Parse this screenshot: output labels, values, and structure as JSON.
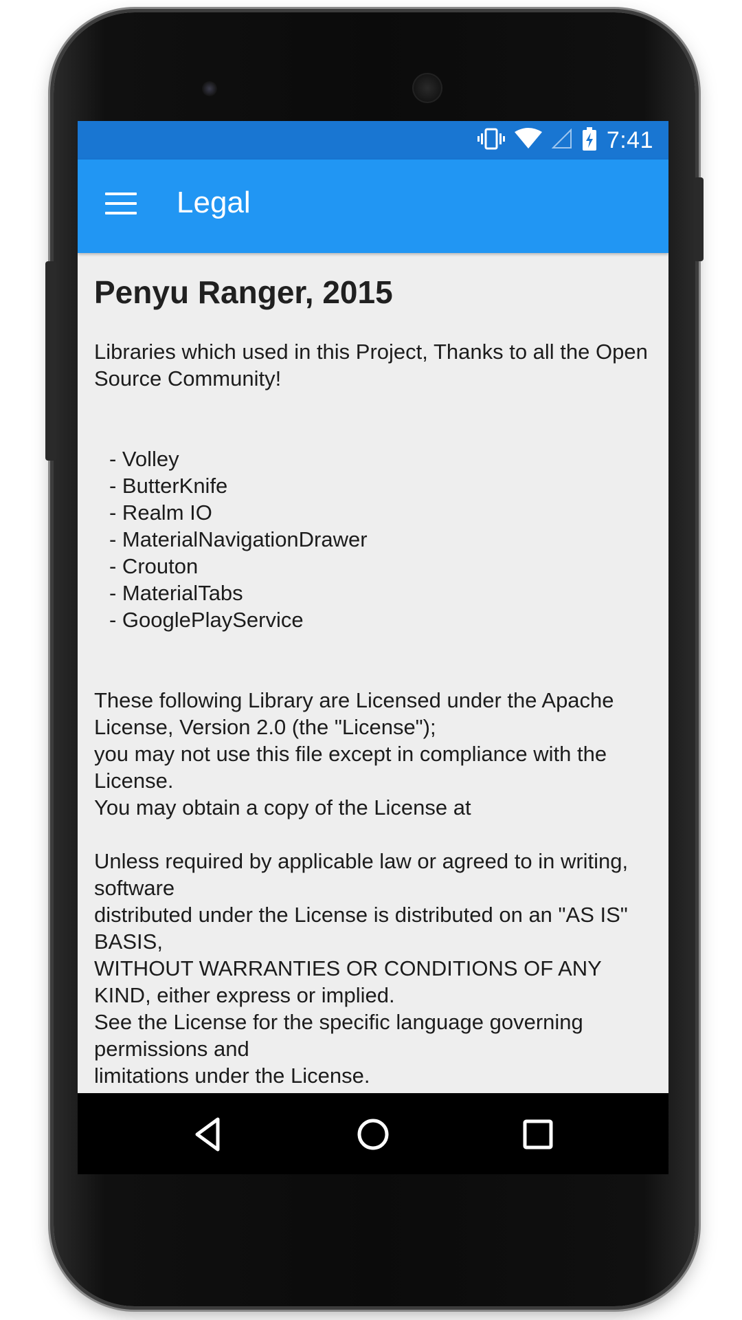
{
  "status_bar": {
    "time": "7:41",
    "icons": [
      "vibrate-icon",
      "wifi-icon",
      "signal-icon",
      "battery-charging-icon"
    ]
  },
  "app_bar": {
    "title": "Legal",
    "menu_icon": "hamburger-menu-icon"
  },
  "content": {
    "heading": "Penyu Ranger, 2015",
    "intro": "Libraries which used in this Project, Thanks to all the Open Source Community!",
    "libraries": [
      "- Volley",
      "- ButterKnife",
      "- Realm IO",
      "- MaterialNavigationDrawer",
      "- Crouton",
      "- MaterialTabs",
      "- GooglePlayService"
    ],
    "license_text": "These following Library are Licensed under the Apache License, Version 2.0 (the \"License\");\nyou may not use this file except in compliance with the License.\nYou may obtain a copy of the License at",
    "disclaimer_text": "Unless required by applicable law or agreed to in writing, software\ndistributed under the License is distributed on an \"AS IS\" BASIS,\nWITHOUT WARRANTIES OR CONDITIONS OF ANY KIND, either express or implied.\nSee the License for the specific language governing permissions and\nlimitations under the License."
  },
  "nav_bar": {
    "buttons": [
      "back-icon",
      "home-icon",
      "recent-apps-icon"
    ]
  },
  "colors": {
    "status_bar": "#1976d2",
    "app_bar": "#2196f3",
    "background": "#eeeeee"
  }
}
